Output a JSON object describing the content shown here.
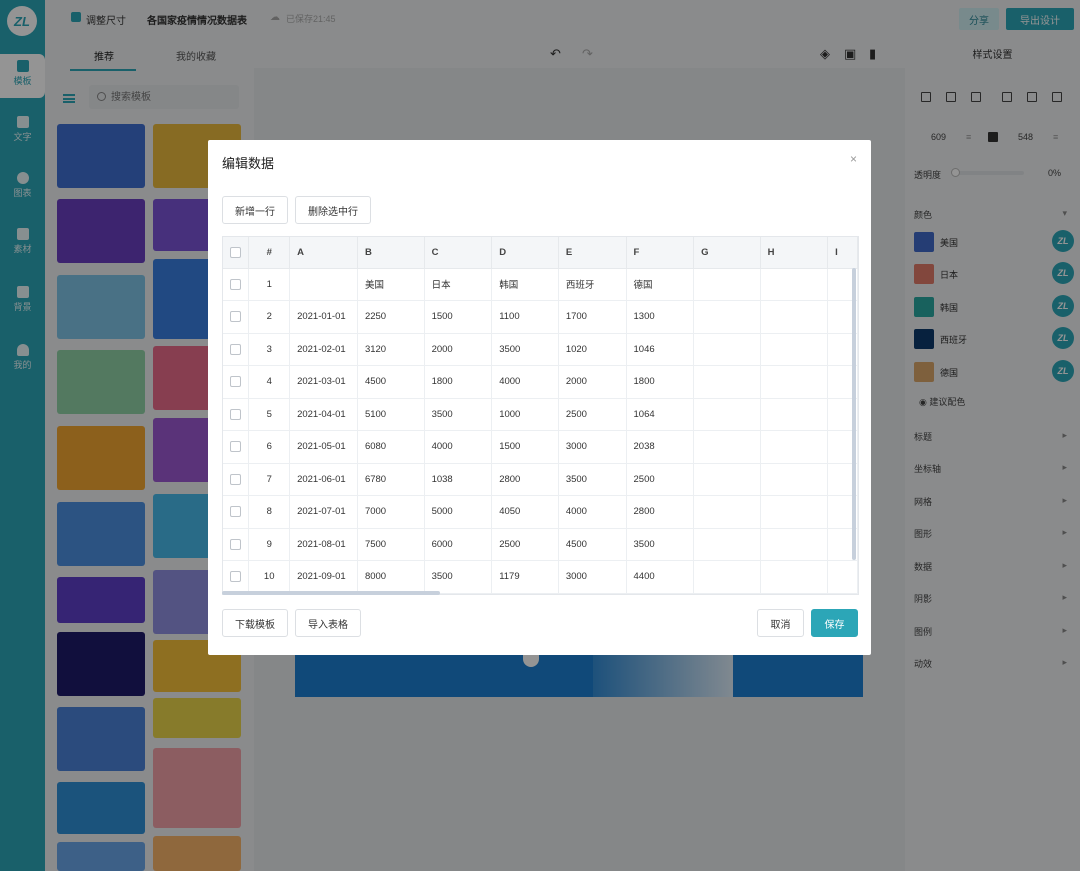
{
  "app": {
    "logo_text": "ZL"
  },
  "rail": {
    "items": [
      {
        "label": "模板",
        "icon": "template-icon"
      },
      {
        "label": "文字",
        "icon": "text-icon"
      },
      {
        "label": "图表",
        "icon": "chart-icon"
      },
      {
        "label": "素材",
        "icon": "material-icon"
      },
      {
        "label": "背景",
        "icon": "background-icon"
      },
      {
        "label": "我的",
        "icon": "cloud-upload-icon"
      }
    ]
  },
  "topbar": {
    "resize_label": "调整尺寸",
    "doc_title": "各国家疫情情况数据表",
    "saved_status": "已保存21:45",
    "share_label": "分享",
    "export_label": "导出设计"
  },
  "left_panel": {
    "tabs": [
      "推荐",
      "我的收藏"
    ],
    "search_placeholder": "搜索模板"
  },
  "right_panel": {
    "title": "样式设置",
    "width": "609",
    "height": "548",
    "opacity_label": "透明度",
    "opacity_value": "0%",
    "color_section": "颜色",
    "colors": [
      {
        "name": "美国",
        "hex": "#4169c9"
      },
      {
        "name": "日本",
        "hex": "#e07b6a"
      },
      {
        "name": "韩国",
        "hex": "#2aa7a0"
      },
      {
        "name": "西班牙",
        "hex": "#0d3a6b"
      },
      {
        "name": "德国",
        "hex": "#d9a56a"
      }
    ],
    "suggest_label": "建议配色",
    "sections": [
      "标题",
      "坐标轴",
      "网格",
      "图形",
      "数据",
      "阴影",
      "图例",
      "动效"
    ]
  },
  "modal": {
    "title": "编辑数据",
    "add_row_label": "新增一行",
    "delete_rows_label": "删除选中行",
    "download_template_label": "下载模板",
    "import_table_label": "导入表格",
    "cancel_label": "取消",
    "save_label": "保存",
    "columns": [
      "#",
      "A",
      "B",
      "C",
      "D",
      "E",
      "F",
      "G",
      "H",
      "I"
    ],
    "rows": [
      [
        "1",
        "",
        "美国",
        "日本",
        "韩国",
        "西班牙",
        "德国",
        "",
        "",
        ""
      ],
      [
        "2",
        "2021-01-01",
        "2250",
        "1500",
        "1100",
        "1700",
        "1300",
        "",
        "",
        ""
      ],
      [
        "3",
        "2021-02-01",
        "3120",
        "2000",
        "3500",
        "1020",
        "1046",
        "",
        "",
        ""
      ],
      [
        "4",
        "2021-03-01",
        "4500",
        "1800",
        "4000",
        "2000",
        "1800",
        "",
        "",
        ""
      ],
      [
        "5",
        "2021-04-01",
        "5100",
        "3500",
        "1000",
        "2500",
        "1064",
        "",
        "",
        ""
      ],
      [
        "6",
        "2021-05-01",
        "6080",
        "4000",
        "1500",
        "3000",
        "2038",
        "",
        "",
        ""
      ],
      [
        "7",
        "2021-06-01",
        "6780",
        "1038",
        "2800",
        "3500",
        "2500",
        "",
        "",
        ""
      ],
      [
        "8",
        "2021-07-01",
        "7000",
        "5000",
        "4050",
        "4000",
        "2800",
        "",
        "",
        ""
      ],
      [
        "9",
        "2021-08-01",
        "7500",
        "6000",
        "2500",
        "4500",
        "3500",
        "",
        "",
        ""
      ],
      [
        "10",
        "2021-09-01",
        "8000",
        "3500",
        "1179",
        "3000",
        "4400",
        "",
        "",
        ""
      ]
    ]
  }
}
